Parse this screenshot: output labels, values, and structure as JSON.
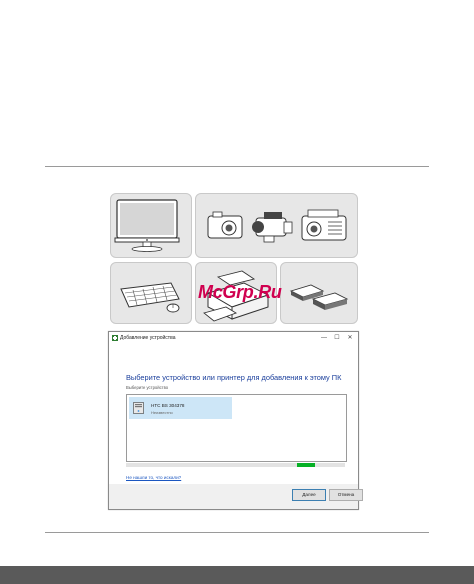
{
  "watermark": "McGrp.Ru",
  "dialog": {
    "title": "Добавление устройства",
    "minimize_glyph": "—",
    "maximize_glyph": "☐",
    "close_glyph": "✕",
    "heading": "Выберите устройство или принтер для добавления к этому ПК",
    "subheading": "Выберите устройство",
    "devices": [
      {
        "name": "HTC BS 304378",
        "status": "Неизвестно",
        "icon": "computer-icon"
      }
    ],
    "progress_fraction": 0.08,
    "link_text": "Не нашли то, что искали?",
    "next_label": "Далее",
    "cancel_label": "Отмена"
  },
  "tiles": [
    {
      "name": "monitor-illustration",
      "icon": "monitor-icon"
    },
    {
      "name": "camera-camcorder-projector-illustration",
      "icon": "camera-icon"
    },
    {
      "name": "keyboard-mouse-illustration",
      "icon": "keyboard-icon"
    },
    {
      "name": "printer-illustration",
      "icon": "printer-icon"
    },
    {
      "name": "storage-drives-illustration",
      "icon": "drive-icon"
    }
  ],
  "colors": {
    "heading": "#1b3f9c",
    "link": "#1b56c0",
    "progress": "#06b025",
    "selection": "#cde6f7",
    "watermark": "#d0004f"
  }
}
